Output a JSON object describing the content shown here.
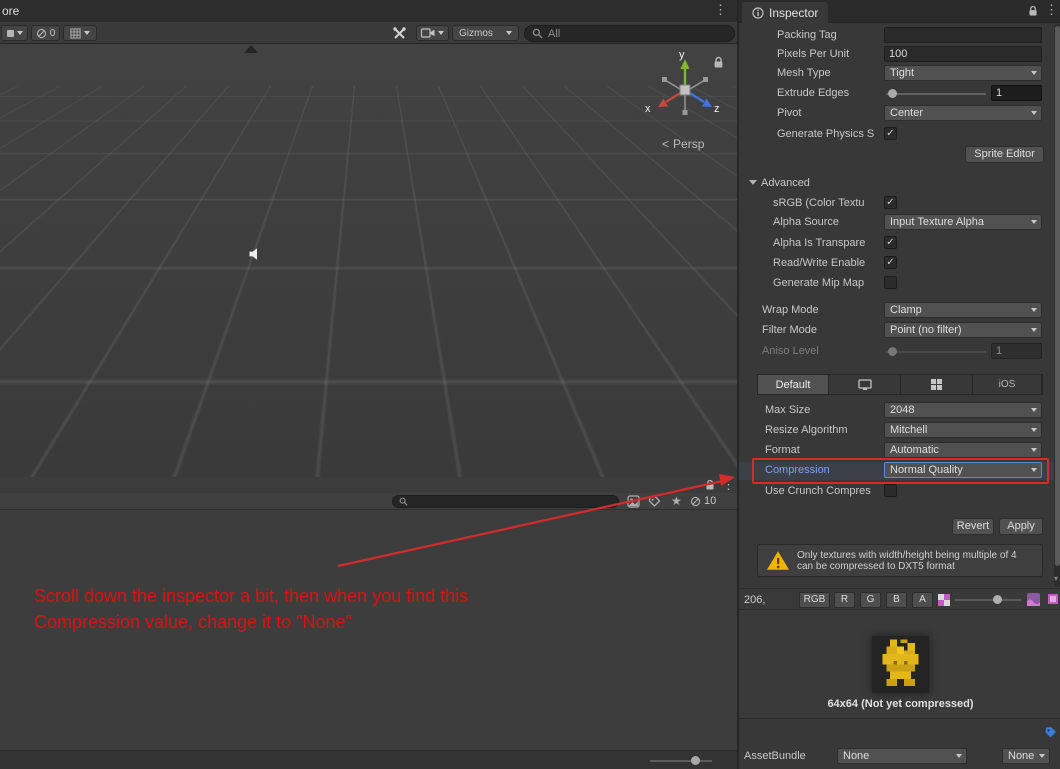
{
  "window": {
    "top_left_text": "ore"
  },
  "icons": {
    "kebab": "⋮",
    "star": "★",
    "chevron_left": "<",
    "down_arrow": "▾"
  },
  "scene_toolbar": {
    "hidden_count": "0",
    "gizmos_label": "Gizmos",
    "search_value": "All"
  },
  "scene": {
    "persp_label": "Persp",
    "axis_x": "x",
    "axis_y": "y",
    "axis_z": "z"
  },
  "project": {
    "hidden_count": "10"
  },
  "annotation": {
    "line1": "Scroll down the inspector a bit, then when you find this",
    "line2": "Compression value, change it to \"None\""
  },
  "inspector": {
    "tab_title": "Inspector",
    "rows": {
      "packing_tag": {
        "label": "Packing Tag",
        "value": ""
      },
      "pixels_per_unit": {
        "label": "Pixels Per Unit",
        "value": "100"
      },
      "mesh_type": {
        "label": "Mesh Type",
        "value": "Tight"
      },
      "extrude_edges": {
        "label": "Extrude Edges",
        "value": "1"
      },
      "pivot": {
        "label": "Pivot",
        "value": "Center"
      },
      "generate_physics": {
        "label": "Generate Physics S",
        "mark": "✓"
      },
      "sprite_editor": "Sprite Editor",
      "advanced": "Advanced",
      "srgb": {
        "label": "sRGB (Color Textu",
        "mark": "✓"
      },
      "alpha_source": {
        "label": "Alpha Source",
        "value": "Input Texture Alpha"
      },
      "alpha_transparency": {
        "label": "Alpha Is Transpare",
        "mark": "✓"
      },
      "read_write": {
        "label": "Read/Write Enable",
        "mark": "✓"
      },
      "mip_maps": {
        "label": "Generate Mip Map",
        "mark": ""
      },
      "wrap_mode": {
        "label": "Wrap Mode",
        "value": "Clamp"
      },
      "filter_mode": {
        "label": "Filter Mode",
        "value": "Point (no filter)"
      },
      "aniso_level": {
        "label": "Aniso Level",
        "value": "1"
      },
      "max_size": {
        "label": "Max Size",
        "value": "2048"
      },
      "resize_algorithm": {
        "label": "Resize Algorithm",
        "value": "Mitchell"
      },
      "format": {
        "label": "Format",
        "value": "Automatic"
      },
      "compression": {
        "label": "Compression",
        "value": "Normal Quality"
      },
      "use_crunch": {
        "label": "Use Crunch Compres",
        "mark": ""
      }
    },
    "platform_tabs": {
      "default": "Default",
      "ios": "iOS"
    },
    "buttons": {
      "revert": "Revert",
      "apply": "Apply"
    },
    "warning_text": "Only textures with width/height being multiple of 4 can be compressed to DXT5 format",
    "preview": {
      "mip_value": "206,",
      "rgb": "RGB",
      "r": "R",
      "g": "G",
      "b": "B",
      "a": "A",
      "caption": "64x64 (Not yet compressed)"
    },
    "assetbundle": {
      "label": "AssetBundle",
      "bundle": "None",
      "variant": "None"
    }
  }
}
